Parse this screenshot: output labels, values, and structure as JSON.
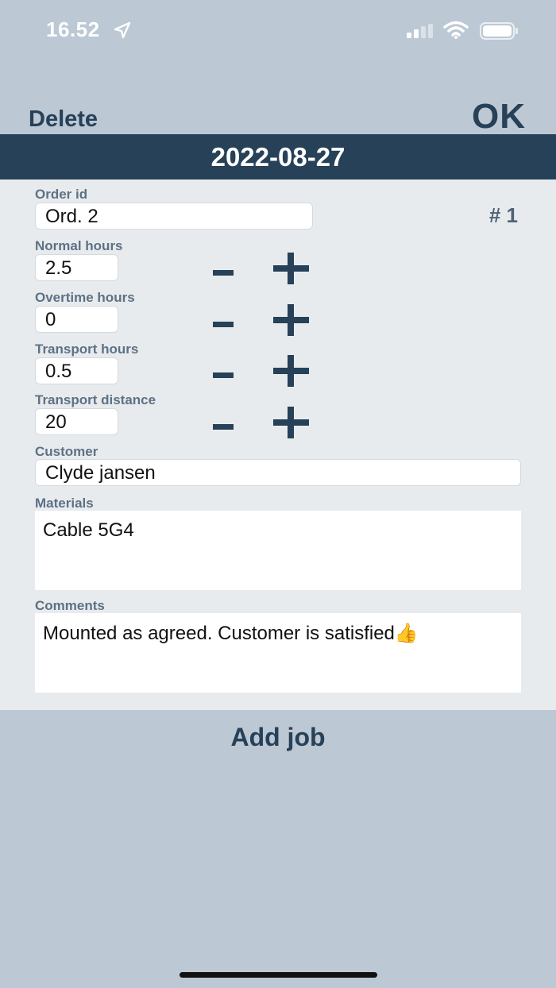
{
  "status_bar": {
    "time": "16.52",
    "location_icon": "location-arrow-icon",
    "signal_icon": "cellular-signal-icon",
    "wifi_icon": "wifi-icon",
    "battery_icon": "battery-icon"
  },
  "nav": {
    "delete_label": "Delete",
    "ok_label": "OK"
  },
  "date": "2022-08-27",
  "form": {
    "order_id": {
      "label": "Order id",
      "value": "Ord. 2"
    },
    "order_number": "# 1",
    "normal_hours": {
      "label": "Normal hours",
      "value": "2.5"
    },
    "overtime_hours": {
      "label": "Overtime hours",
      "value": "0"
    },
    "transport_hours": {
      "label": "Transport hours",
      "value": "0.5"
    },
    "transport_distance": {
      "label": "Transport distance",
      "value": "20"
    },
    "customer": {
      "label": "Customer",
      "value": "Clyde jansen"
    },
    "materials": {
      "label": "Materials",
      "value": "Cable 5G4"
    },
    "comments": {
      "label": "Comments",
      "value": "Mounted as agreed. Customer is satisfied👍"
    }
  },
  "add_job_label": "Add job",
  "colors": {
    "background": "#bcc8d4",
    "panel": "#e8ebee",
    "accent": "#264158",
    "label": "#5d7184"
  }
}
